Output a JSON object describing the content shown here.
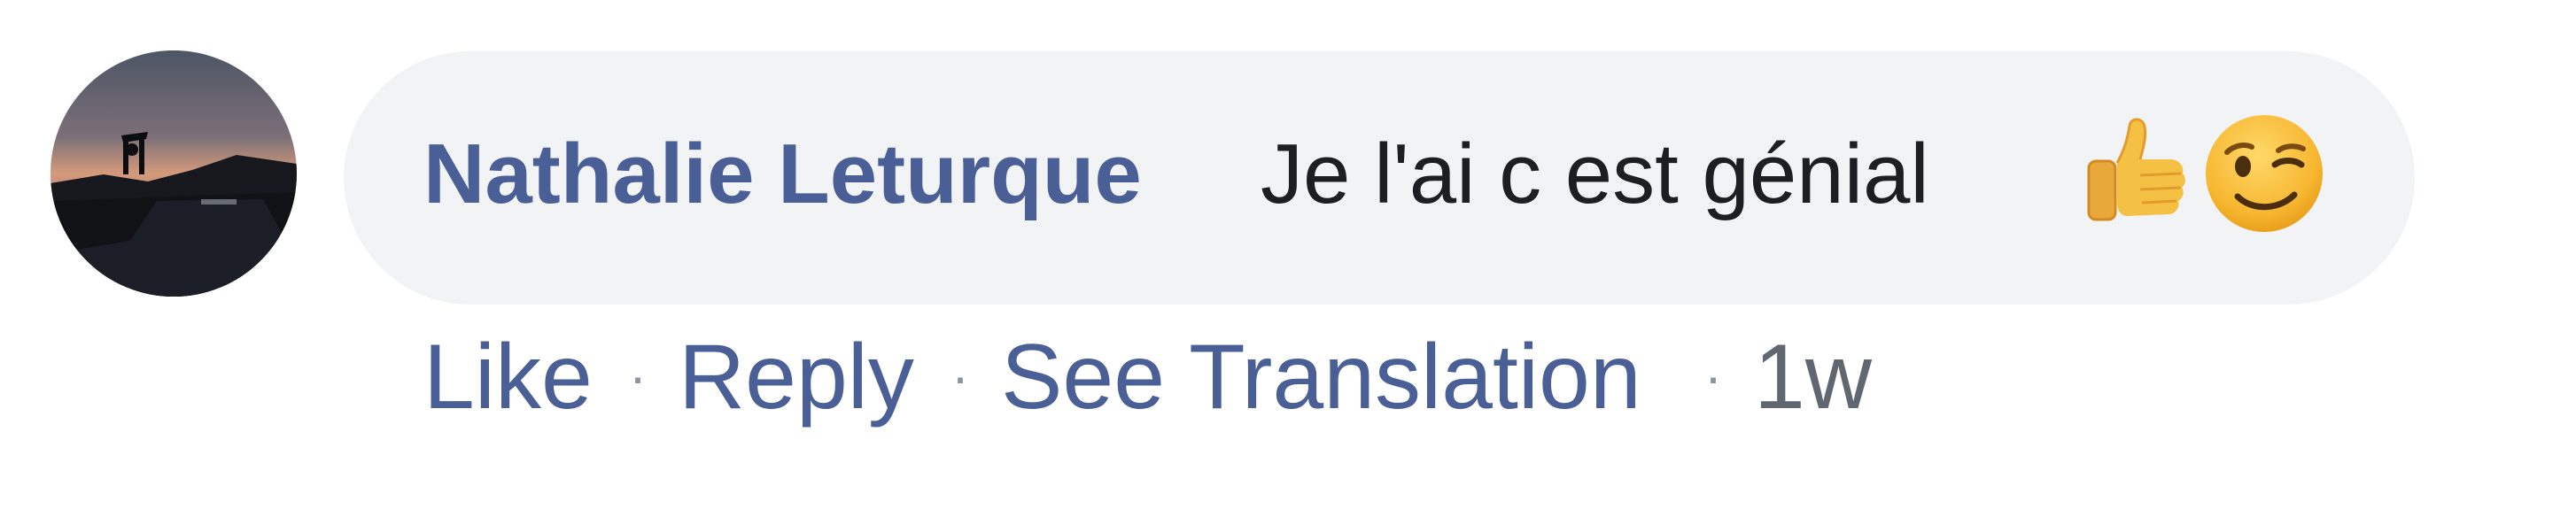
{
  "comment": {
    "author": "Nathalie Leturque",
    "text": "Je l'ai c est génial",
    "emojis": [
      "thumbs-up-icon",
      "winking-face-icon"
    ]
  },
  "actions": {
    "like": "Like",
    "reply": "Reply",
    "see_translation": "See Translation",
    "separator": "·",
    "timestamp": "1w"
  },
  "colors": {
    "link": "#4b5f97",
    "text": "#1c1e21",
    "bubble": "#f2f3f5",
    "muted": "#606770"
  }
}
